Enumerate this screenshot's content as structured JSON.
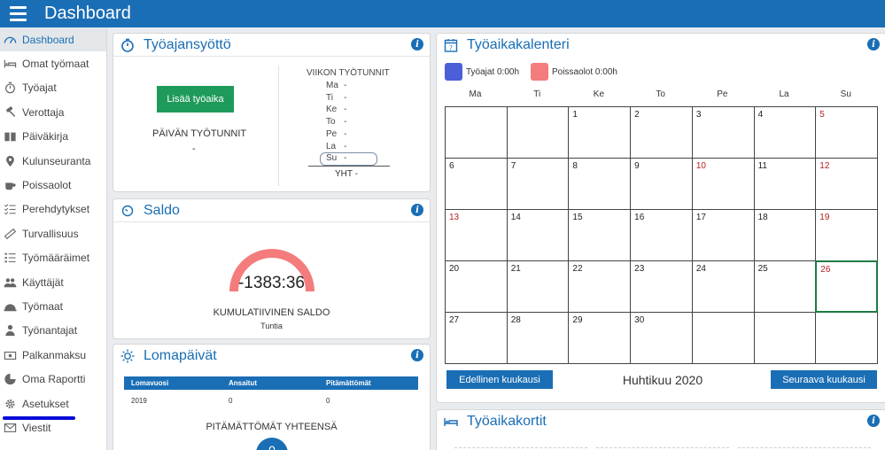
{
  "header": {
    "title": "Dashboard"
  },
  "sidebar": {
    "items": [
      {
        "label": "Dashboard",
        "icon": "dashboard-icon"
      },
      {
        "label": "Omat työmaat",
        "icon": "bed-icon"
      },
      {
        "label": "Työajat",
        "icon": "stopwatch-icon"
      },
      {
        "label": "Verottaja",
        "icon": "gavel-icon"
      },
      {
        "label": "Päiväkirja",
        "icon": "book-icon"
      },
      {
        "label": "Kulunseuranta",
        "icon": "map-marker-icon"
      },
      {
        "label": "Poissaolot",
        "icon": "coffee-icon"
      },
      {
        "label": "Perehdytykset",
        "icon": "checklist-icon"
      },
      {
        "label": "Turvallisuus",
        "icon": "ruler-icon"
      },
      {
        "label": "Työmääräimet",
        "icon": "list-icon"
      },
      {
        "label": "Käyttäjät",
        "icon": "users-icon"
      },
      {
        "label": "Työmaat",
        "icon": "helmet-icon"
      },
      {
        "label": "Työnantajat",
        "icon": "person-icon"
      },
      {
        "label": "Palkanmaksu",
        "icon": "money-icon"
      },
      {
        "label": "Oma Raportti",
        "icon": "pie-chart-icon"
      },
      {
        "label": "Asetukset",
        "icon": "gear-icon"
      },
      {
        "label": "Viestit",
        "icon": "envelope-icon"
      }
    ]
  },
  "tyoajansyotto": {
    "title": "Työajansyöttö",
    "add_button": "Lisää työaika",
    "day_hours_label": "PÄIVÄN TYÖTUNNIT",
    "day_hours_value": "-",
    "week_hours_label": "VIIKON TYÖTUNNIT",
    "week_rows": [
      {
        "day": "Ma",
        "value": "-"
      },
      {
        "day": "Ti",
        "value": "-"
      },
      {
        "day": "Ke",
        "value": "-"
      },
      {
        "day": "To",
        "value": "-"
      },
      {
        "day": "Pe",
        "value": "-"
      },
      {
        "day": "La",
        "value": "-"
      },
      {
        "day": "Su",
        "value": "-"
      }
    ],
    "total": "YHT -"
  },
  "saldo": {
    "title": "Saldo",
    "value": "-1383:36",
    "label": "KUMULATIIVINEN SALDO",
    "unit": "Tuntia",
    "gauge_color": "#f47c7c"
  },
  "lomapaivat": {
    "title": "Lomapäivät",
    "columns": [
      "Lomavuosi",
      "Ansaitut",
      "Pitämättömät"
    ],
    "rows": [
      [
        "2019",
        "0",
        "0"
      ]
    ],
    "total_label": "PITÄMÄTTÖMÄT YHTEENSÄ",
    "total_value": "0"
  },
  "calendar": {
    "title": "Työaikakalenteri",
    "legend": [
      {
        "label": "Työajat 0:00h",
        "color": "#4a5fd8"
      },
      {
        "label": "Poissaolot 0:00h",
        "color": "#f47c7c"
      }
    ],
    "weekdays": [
      "Ma",
      "Ti",
      "Ke",
      "To",
      "Pe",
      "La",
      "Su"
    ],
    "weeks": [
      [
        "",
        "",
        "1",
        "2",
        "3",
        "4",
        "5"
      ],
      [
        "6",
        "7",
        "8",
        "9",
        "10",
        "11",
        "12"
      ],
      [
        "13",
        "14",
        "15",
        "16",
        "17",
        "18",
        "19"
      ],
      [
        "20",
        "21",
        "22",
        "23",
        "24",
        "25",
        "26"
      ],
      [
        "27",
        "28",
        "29",
        "30",
        "",
        "",
        ""
      ]
    ],
    "holidays": [
      "10",
      "13"
    ],
    "today": "26",
    "prev_button": "Edellinen kuukausi",
    "next_button": "Seuraava kuukausi",
    "month_label": "Huhtikuu 2020"
  },
  "tyoaikakortit": {
    "title": "Työaikakortit"
  },
  "colors": {
    "brand": "#1a6eb5",
    "green": "#1e9a5a",
    "sunday_red": "#b42020"
  }
}
